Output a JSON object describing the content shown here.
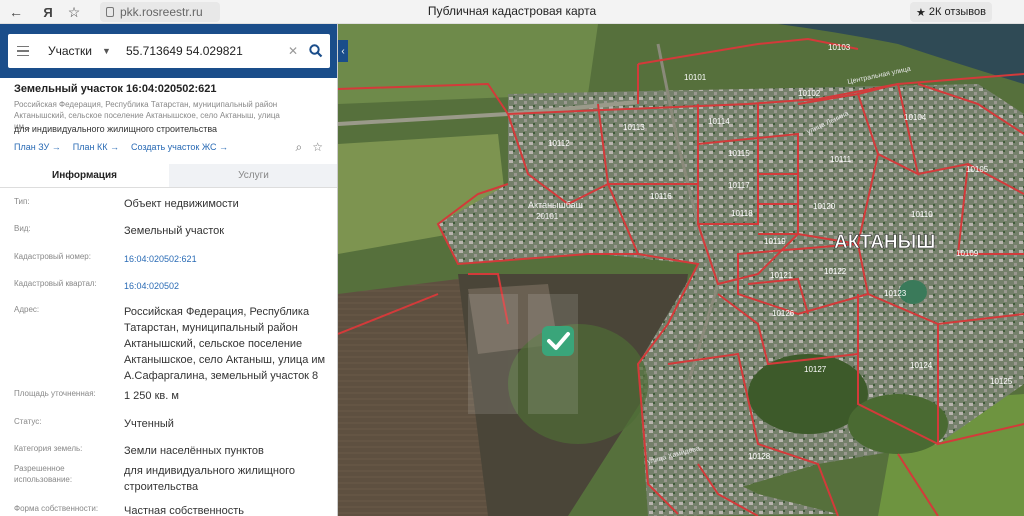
{
  "browser": {
    "url": "pkk.rosreestr.ru",
    "page_title": "Публичная кадастровая карта",
    "reviews": "2К отзывов",
    "back_icon": "back-arrow-icon",
    "yandex_icon": "yandex-logo-icon",
    "bookmark_icon": "star-icon"
  },
  "search": {
    "category": "Участки",
    "query": "55.713649 54.029821"
  },
  "object": {
    "title": "Земельный участок 16:04:020502:621",
    "address_short": "Российская Федерация, Республика Татарстан, муниципальный район Актанышский, сельское поселение Актанышское, село Актаныш, улица им...",
    "purpose": "для индивидуального жилищного строительства",
    "links": [
      "План ЗУ",
      "План КК",
      "Создать участок ЖС"
    ]
  },
  "tabs": [
    "Информация",
    "Услуги"
  ],
  "info": {
    "type_label": "Тип:",
    "type_value": "Объект недвижимости",
    "kind_label": "Вид:",
    "kind_value": "Земельный участок",
    "cadnum_label": "Кадастровый номер:",
    "cadnum_value": "16:04:020502:621",
    "quarter_label": "Кадастровый квартал:",
    "quarter_value": "16:04:020502",
    "address_label": "Адрес:",
    "address_value": "Российская Федерация, Республика Татарстан, муниципальный район Актанышский, сельское поселение Актанышское, село Актаныш, улица им А.Сафаргалина, земельный участок 8",
    "area_label": "Площадь уточненная:",
    "area_value": "1 250 кв. м",
    "status_label": "Статус:",
    "status_value": "Учтенный",
    "category_label": "Категория земель:",
    "category_value": "Земли населённых пунктов",
    "use_label": "Разрешенное использование:",
    "use_value": "для индивидуального жилищного строительства",
    "ownership_label": "Форма собственности:",
    "ownership_value": "Частная собственность"
  },
  "map": {
    "town_label": "АКТАНЫШ",
    "village_label": "Актанышбаш",
    "village_code": "20101",
    "street_labels": [
      "Центральная улица",
      "улица Ленина",
      "улица Хамидова"
    ],
    "quarters": [
      "10103",
      "10101",
      "10102",
      "10112",
      "10113",
      "10114",
      "10104",
      "10115",
      "10111",
      "10116",
      "10117",
      "10118",
      "10120",
      "10105",
      "10110",
      "10119",
      "10121",
      "10122",
      "10109",
      "10123",
      "10126",
      "10124",
      "10127",
      "10125",
      "10128"
    ]
  }
}
